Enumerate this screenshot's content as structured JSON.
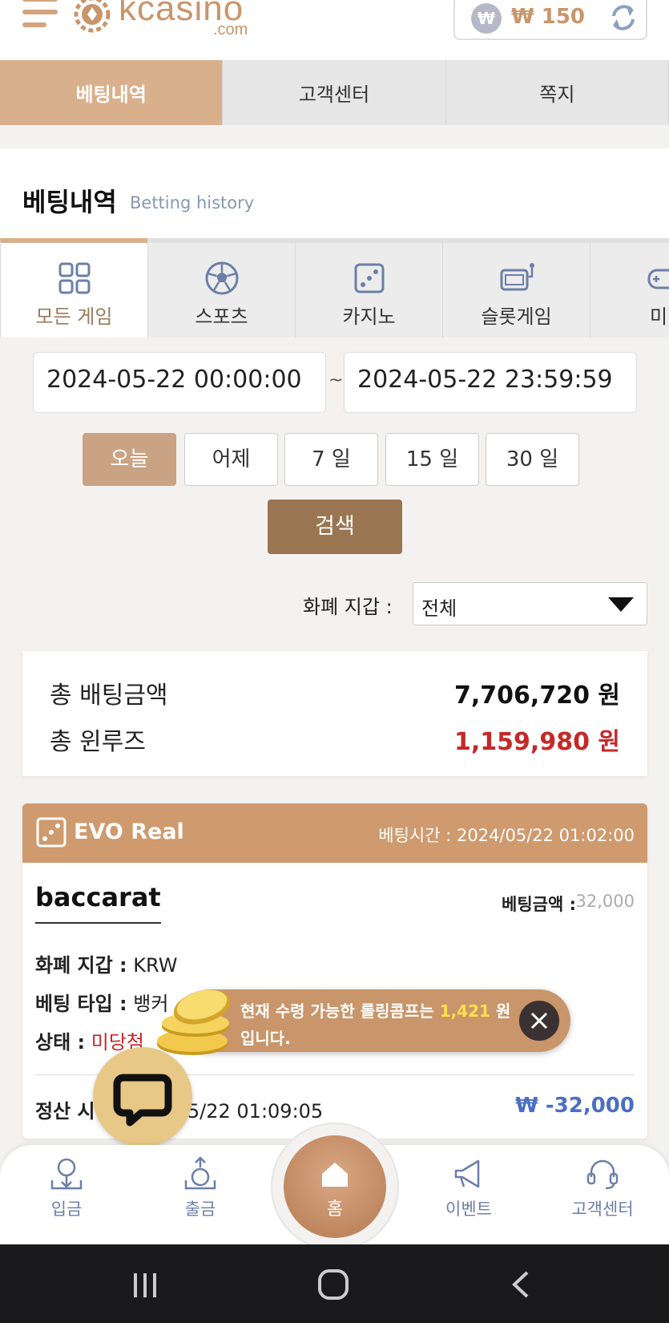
{
  "header": {
    "logo_text": "kcasino",
    "logo_sub": ".com",
    "currency_symbol": "₩",
    "balance": "₩ 150"
  },
  "top_tabs": [
    {
      "label": "베팅내역",
      "active": true
    },
    {
      "label": "고객센터",
      "active": false
    },
    {
      "label": "쪽지",
      "active": false
    }
  ],
  "section": {
    "title": "베팅내역",
    "subtitle": "Betting history"
  },
  "game_tabs": [
    {
      "label": "모든 게임",
      "icon": "grid-icon",
      "active": true
    },
    {
      "label": "스포츠",
      "icon": "soccer-ball-icon",
      "active": false
    },
    {
      "label": "카지노",
      "icon": "dice-icon",
      "active": false
    },
    {
      "label": "슬롯게임",
      "icon": "slot-machine-icon",
      "active": false
    },
    {
      "label": "미니",
      "icon": "gamepad-icon",
      "active": false
    }
  ],
  "date_range": {
    "start": "2024-05-22 00:00:00",
    "separator": "~",
    "end": "2024-05-22 23:59:59"
  },
  "quick_ranges": [
    {
      "label": "오늘",
      "active": true
    },
    {
      "label": "어제",
      "active": false
    },
    {
      "label": "7 일",
      "active": false
    },
    {
      "label": "15 일",
      "active": false
    },
    {
      "label": "30 일",
      "active": false
    }
  ],
  "search_label": "검색",
  "currency_filter": {
    "label": "화폐 지갑 :",
    "value": "전체"
  },
  "summary": {
    "total_bet_label": "총 배팅금액",
    "total_bet_value": "7,706,720 원",
    "total_winloss_label": "총 윈루즈",
    "total_winloss_value": "1,159,980 원",
    "winloss_color": "#c62828"
  },
  "bet_record": {
    "provider": "EVO Real",
    "bet_time_label": "베팅시간 :",
    "bet_time": "2024/05/22 01:02:00",
    "game": "baccarat",
    "bet_amount_label": "베팅금액 :",
    "bet_amount": "32,000",
    "wallet_label": "화폐 지갑 :",
    "wallet_value": "KRW",
    "bet_type_label": "베팅 타입 :",
    "bet_type_value": "뱅커",
    "status_label": "상태 :",
    "status_value": "미당첨",
    "settle_label": "정산 시",
    "settle_time": "05/22 01:09:05",
    "settle_amount": "₩ -32,000"
  },
  "toast": {
    "text_before": "현재 수령 가능한 롤링콤프는 ",
    "amount": "1,421",
    "text_after": " 원 입니다."
  },
  "bottom_nav": [
    {
      "label": "입금",
      "icon": "deposit-icon"
    },
    {
      "label": "출금",
      "icon": "withdraw-icon"
    },
    {
      "label": "홈",
      "icon": "home-icon"
    },
    {
      "label": "이벤트",
      "icon": "megaphone-icon"
    },
    {
      "label": "고객센터",
      "icon": "headset-icon"
    }
  ],
  "colors": {
    "accent": "#d9b08c",
    "brand": "#c9956a",
    "search_button": "#9a7552",
    "settle_amount": "#4a6fc0"
  }
}
